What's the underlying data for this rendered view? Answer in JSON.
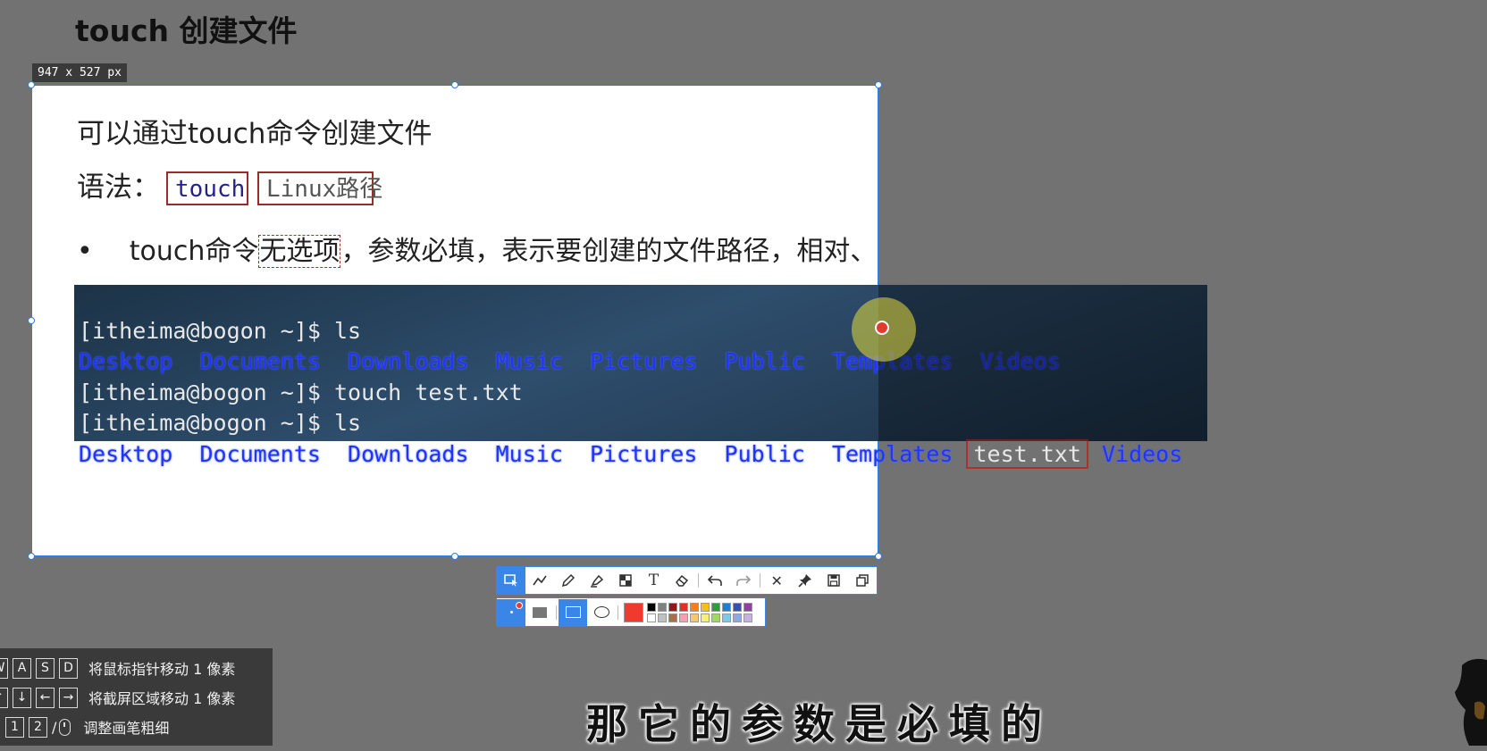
{
  "page_title": "touch 创建文件",
  "capture_size_label": "947 x 527  px",
  "slide": {
    "heading": "可以通过touch命令创建文件",
    "syntax_label": "语法：",
    "syntax_cmd": "touch",
    "syntax_arg": "Linux路径",
    "bullet": "•",
    "bullet_before": "touch命令",
    "bullet_highlight": "无选项",
    "bullet_after": "，参数必填，表示要创建的文件路径，相对、绝对、特殊路径符均可以使用"
  },
  "terminal": {
    "line1": "[itheima@bogon ~]$ ls",
    "dirs1": [
      "Desktop",
      "Documents",
      "Downloads",
      "Music",
      "Pictures",
      "Public",
      "Templates",
      "Videos"
    ],
    "line3": "[itheima@bogon ~]$ touch test.txt",
    "line4": "[itheima@bogon ~]$ ls",
    "dirs2": [
      "Desktop",
      "Documents",
      "Downloads",
      "Music",
      "Pictures",
      "Public",
      "Templates"
    ],
    "new_file": "test.txt",
    "dirs2_last": "Videos"
  },
  "toolbar": {
    "tools": [
      "select-icon",
      "polyline-icon",
      "pen-icon",
      "highlighter-icon",
      "mosaic-icon",
      "text-icon",
      "eraser-icon",
      "undo-icon",
      "redo-icon",
      "close-icon",
      "pin-icon",
      "save-icon",
      "copy-icon"
    ],
    "text_tool_label": "T",
    "close_label": "✕",
    "selected_color": "#f03a2e",
    "palette": [
      "#000000",
      "#808080",
      "#8b1a1a",
      "#e0302a",
      "#f08020",
      "#f4c020",
      "#2e9e3a",
      "#1e7fd0",
      "#3a4fb0",
      "#9040a0",
      "#ffffff",
      "#c0c0c0",
      "#a57050",
      "#f4a0b0",
      "#f4c870",
      "#f8f070",
      "#a0d860",
      "#80c8e8",
      "#90a8e0",
      "#c8b0e0"
    ]
  },
  "help": {
    "row1_keys": [
      "W",
      "A",
      "S",
      "D"
    ],
    "row1_text": "将鼠标指针移动 1 像素",
    "row2_keys": [
      "↑",
      "↓",
      "←",
      "→"
    ],
    "row2_text": "将截屏区域移动 1 像素",
    "row3_keys": [
      "1",
      "2"
    ],
    "row3_sep": "/",
    "row3_text": "调整画笔粗细"
  },
  "subtitle": "那它的参数是必填的"
}
